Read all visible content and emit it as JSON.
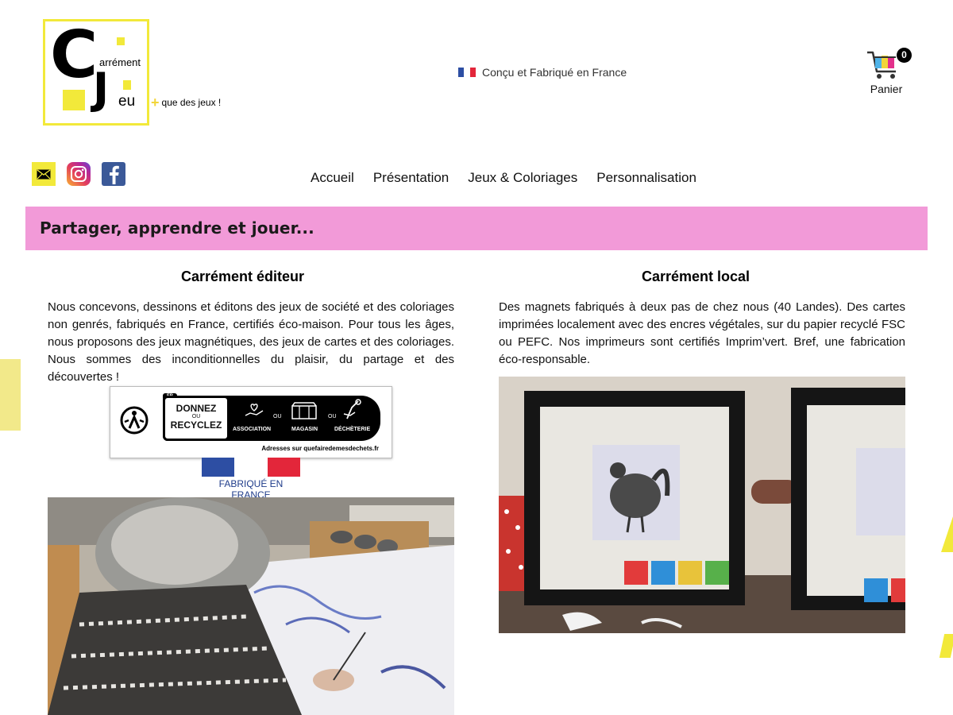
{
  "brand": {
    "logo_letter_c": "C",
    "logo_word1": "arrément",
    "logo_letter_j": "J",
    "logo_word2": "eu",
    "tagline": "que des jeux !"
  },
  "header": {
    "made_in": "Conçu et Fabriqué en France",
    "cart_count": "0",
    "cart_label": "Panier"
  },
  "social": [
    "mail-icon",
    "instagram-icon",
    "facebook-icon"
  ],
  "nav": {
    "items": [
      "Accueil",
      "Présentation",
      "Jeux & Coloriages",
      "Personnalisation"
    ],
    "active": "Accueil"
  },
  "banner": {
    "title": "Partager, apprendre et jouer..."
  },
  "left": {
    "title": "Carrément éditeur",
    "text": "Nous concevons, dessinons et éditons des jeux de société et des coloriages non genrés, fabriqués en France, certifiés éco-maison. Pour tous les âges, nous proposons des jeux magnétiques, des jeux de cartes et des coloriages. Nous sommes des inconditionnelles du plaisir, du partage et des découvertes !",
    "recycle": {
      "fr": "FR",
      "donnez": "DONNEZ",
      "ou_small": "OU",
      "recyclez": "RECYCLEZ",
      "ou": "OU",
      "association": "ASSOCIATION",
      "magasin": "MAGASIN",
      "decheterie": "DÉCHÈTERIE",
      "address": "Adresses sur quefairedemesdechets.fr"
    },
    "flag_label": "FABRIQUÉ EN FRANCE"
  },
  "right": {
    "title": "Carrément local",
    "text": "Des magnets fabriqués à deux pas de chez nous (40 Landes). Des cartes imprimées localement avec des encres végétales, sur du papier recyclé FSC ou PEFC. Nos imprimeurs sont certifiés Imprim’vert. Bref, une fabrication éco-responsable."
  },
  "colors": {
    "accent_yellow": "#f2e93a",
    "accent_green": "#9ab84b",
    "banner_pink": "#f29ad8",
    "france_blue": "#2d4ea3",
    "france_red": "#e3263a"
  }
}
